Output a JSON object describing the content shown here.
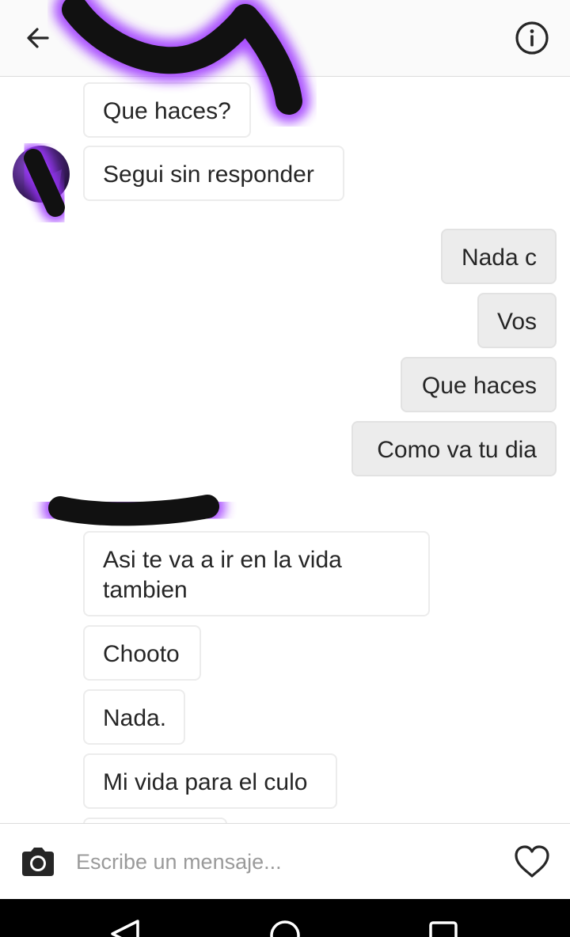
{
  "header": {
    "back_icon": "arrow-left-icon",
    "title": "",
    "info_icon": "info-circle-icon"
  },
  "conversation": {
    "incoming_group_1": [
      {
        "text": "Que haces?"
      },
      {
        "text": "Segui sin responder"
      }
    ],
    "outgoing_group": [
      {
        "text": "Nada c"
      },
      {
        "text": "Vos"
      },
      {
        "text": "Que haces"
      },
      {
        "text": "Como va tu dia"
      }
    ],
    "incoming_group_2": {
      "sender_name": "",
      "messages": [
        {
          "text": "Asi te va a ir en la vida tambien"
        },
        {
          "text": "Chooto"
        },
        {
          "text": "Nada."
        },
        {
          "text": "Mi vida para el culo"
        }
      ]
    }
  },
  "composer": {
    "camera_icon": "camera-icon",
    "input_value": "",
    "input_placeholder": "Escribe un mensaje...",
    "like_icon": "heart-icon"
  },
  "system_nav": {
    "back_icon": "triangle-back-icon",
    "home_icon": "circle-home-icon",
    "recents_icon": "square-recents-icon"
  },
  "colors": {
    "incoming_bubble_bg": "#ffffff",
    "incoming_bubble_border": "#ececec",
    "outgoing_bubble_bg": "#ececec",
    "text": "#262626",
    "placeholder": "#9a9a9a",
    "redaction_ink": "#111111",
    "redaction_glow": "#9b30ff",
    "nav_bar": "#000000"
  }
}
